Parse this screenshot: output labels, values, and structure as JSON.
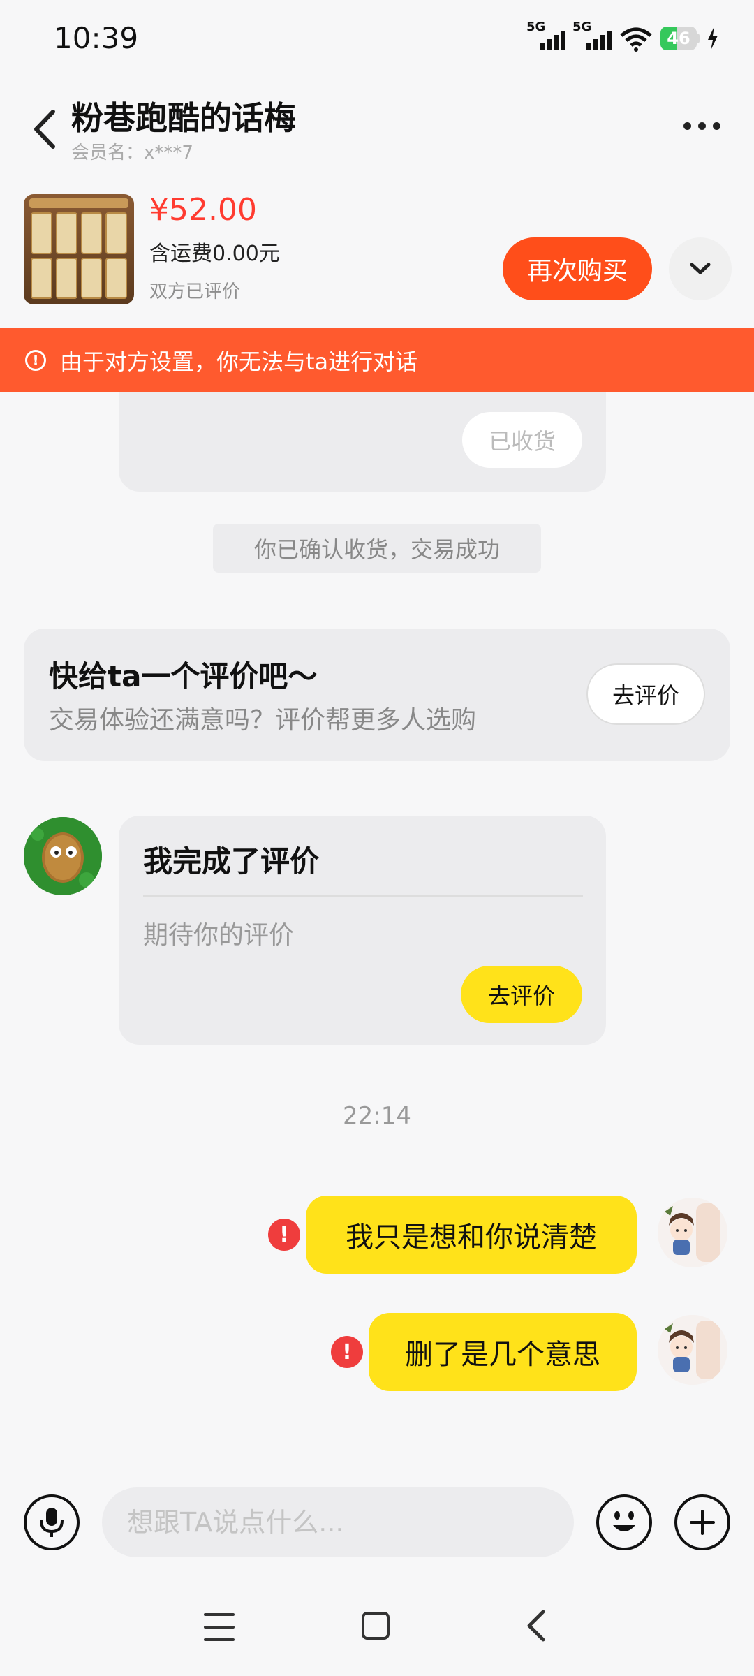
{
  "status_bar": {
    "time": "10:39",
    "signal1_label": "5G",
    "signal2_label": "5G",
    "battery_level": "46"
  },
  "header": {
    "title": "粉巷跑酷的话梅",
    "subtitle": "会员名：x***7"
  },
  "product": {
    "price": "¥52.00",
    "shipping": "含运费0.00元",
    "review_status": "双方已评价",
    "buy_again_label": "再次购买"
  },
  "banner": {
    "text": "由于对方设置，你无法与ta进行对话",
    "icon": "alert-circle-icon"
  },
  "chat": {
    "received_label": "已收货",
    "system_message": "你已确认收货，交易成功",
    "review_prompt": {
      "title": "快给ta一个评价吧～",
      "subtitle": "交易体验还满意吗？评价帮更多人选购",
      "button": "去评价"
    },
    "peer_card": {
      "title": "我完成了评价",
      "subtitle": "期待你的评价",
      "button": "去评价"
    },
    "timestamp": "22:14",
    "outgoing": [
      {
        "text": "我只是想和你说清楚",
        "status": "failed"
      },
      {
        "text": "删了是几个意思",
        "status": "failed"
      }
    ]
  },
  "input_bar": {
    "placeholder": "想跟TA说点什么..."
  },
  "colors": {
    "accent_orange": "#ff4e1a",
    "banner": "#ff5a2e",
    "price_red": "#ff3b30",
    "bubble_yellow": "#ffe21a",
    "error_red": "#ef3d3d"
  }
}
